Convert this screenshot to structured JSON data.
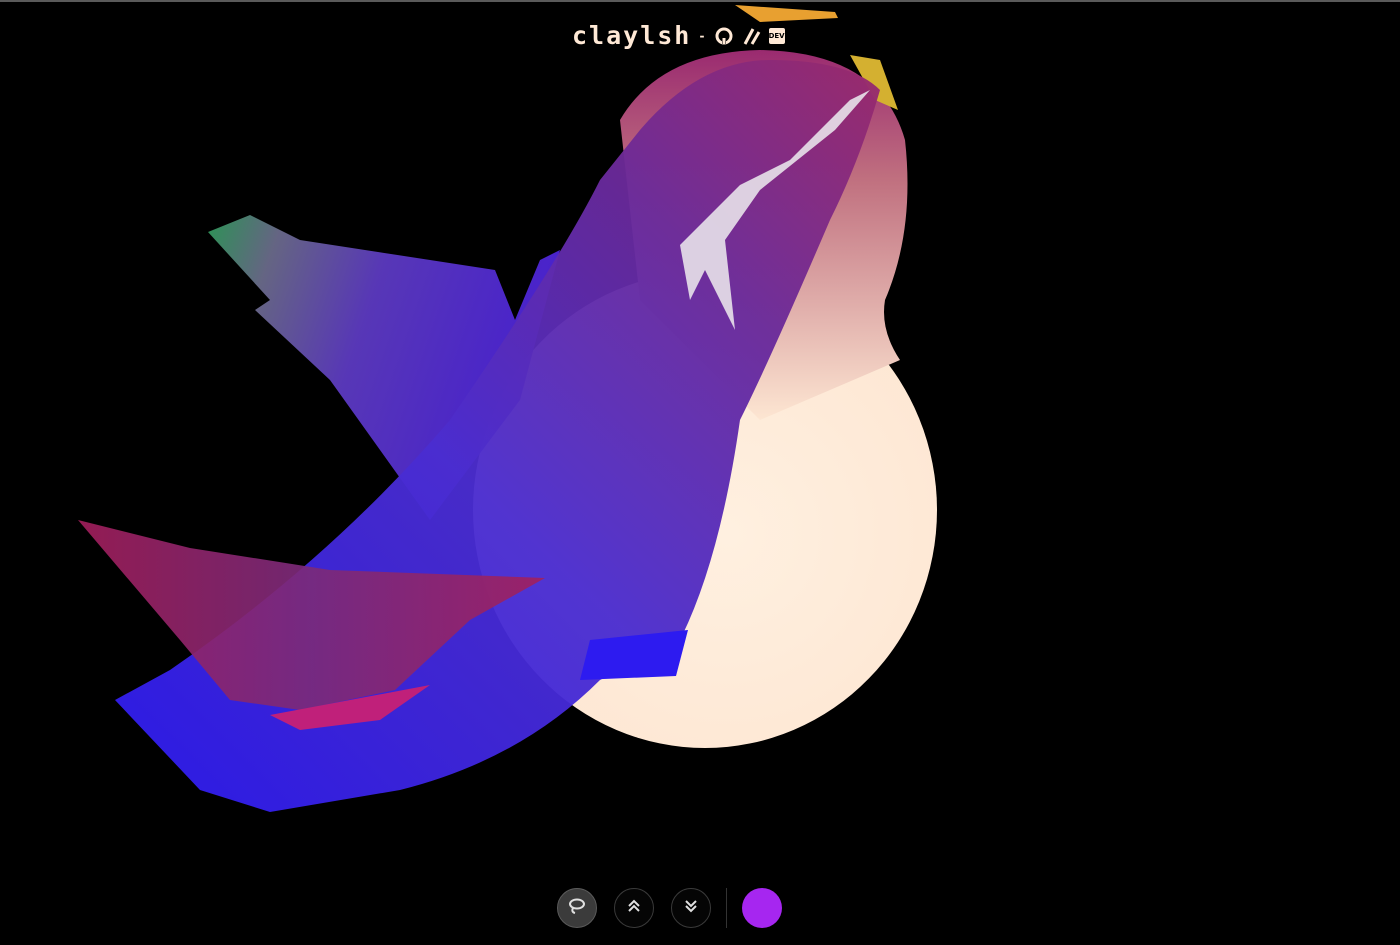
{
  "header": {
    "brand": "claylsh",
    "separator": "-",
    "github_icon": "github-icon",
    "edit_icon": "slash-edit-icon",
    "dev_badge": "DEV"
  },
  "toolbar": {
    "buttons": [
      {
        "icon": "lasso-icon",
        "active": true
      },
      {
        "icon": "chevrons-up-icon",
        "active": false
      },
      {
        "icon": "chevrons-down-icon",
        "active": false
      }
    ],
    "color_swatch": "#a626f0"
  },
  "colors": {
    "background": "#000000",
    "cream": "#ffe9d6",
    "blue": "#2d1bf0",
    "purple": "#6a2aa8",
    "magenta": "#b01e6a",
    "green": "#2f9a5a"
  }
}
